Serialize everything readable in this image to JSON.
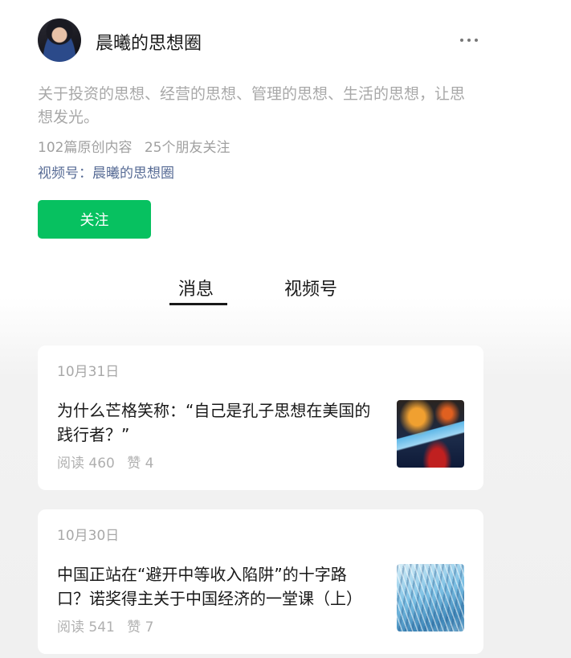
{
  "profile": {
    "name": "晨曦的思想圈",
    "description": "关于投资的思想、经营的思想、管理的思想、生活的思想，让思想发光。",
    "original_count": "102篇原创内容",
    "friends_following": "25个朋友关注",
    "channels_label": "视频号：晨曦的思想圈",
    "follow_label": "关注"
  },
  "icons": {
    "more": "more-icon",
    "avatar": "avatar"
  },
  "tabs": [
    {
      "label": "消息",
      "active": true
    },
    {
      "label": "视频号",
      "active": false
    }
  ],
  "articles": [
    {
      "date": "10月31日",
      "title": "为什么芒格笑称：“自己是孔子思想在美国的践行者？”",
      "reads": "阅读 460",
      "likes": "赞 4"
    },
    {
      "date": "10月30日",
      "title": "中国正站在“避开中等收入陷阱”的十字路口？诺奖得主关于中国经济的一堂课（上）",
      "reads": "阅读 541",
      "likes": "赞 7"
    }
  ],
  "colors": {
    "accent": "#07c160",
    "link": "#576b95"
  }
}
